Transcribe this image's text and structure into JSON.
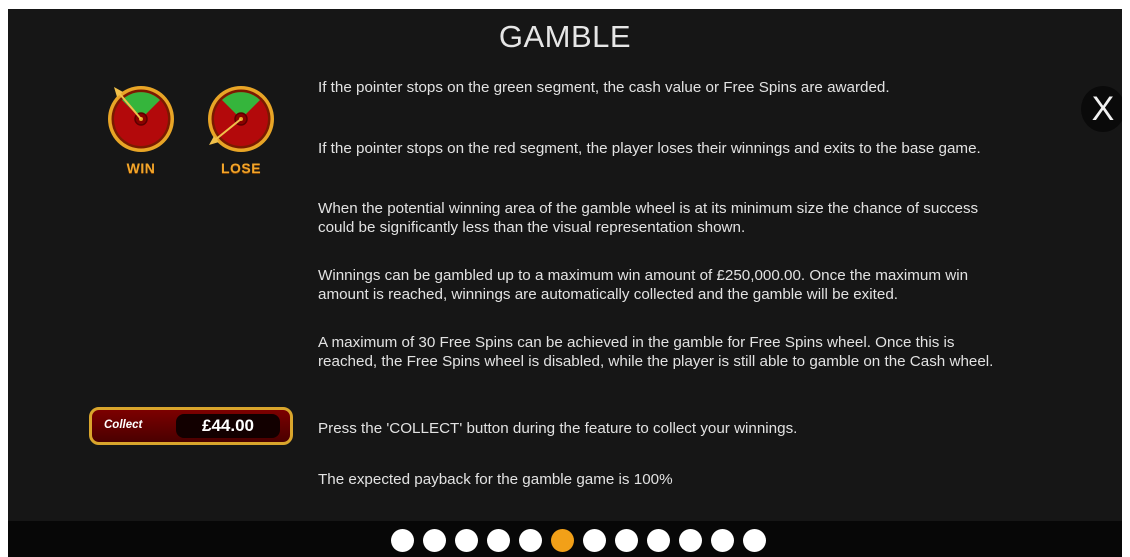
{
  "header": {
    "title": "GAMBLE",
    "close_label": "X"
  },
  "icons": {
    "win_wheel_icon": "gamble-wheel-win",
    "lose_wheel_icon": "gamble-wheel-lose"
  },
  "legend": {
    "win_label": "WIN",
    "lose_label": "LOSE"
  },
  "collect": {
    "label": "Collect",
    "amount": "£44.00"
  },
  "paragraphs": [
    "If the pointer stops on the green segment, the cash value or Free Spins are awarded.",
    "If the pointer stops on the red segment, the player loses their winnings and exits to the base game.",
    "When the potential winning area of the gamble wheel is at its minimum size the chance of success could be significantly less than the visual representation shown.",
    "Winnings can be gambled up to a maximum win amount of £250,000.00. Once the maximum win amount is reached, winnings are automatically collected and the gamble will be exited.",
    "A maximum of 30 Free Spins can be achieved in the gamble for Free Spins wheel. Once this is reached, the Free Spins wheel is disabled, while the player is still able to gamble on the Cash wheel.",
    "Press the 'COLLECT' button during the feature to collect your winnings.",
    "The expected payback for the gamble game is 100%"
  ],
  "pagination": {
    "total_pages": 12,
    "current_page": 6
  },
  "colors": {
    "background": "#161616",
    "accent_gold": "#f2a018",
    "wheel_red": "#b3090b",
    "wheel_green": "#35b53c",
    "text": "#e2e2e2"
  }
}
